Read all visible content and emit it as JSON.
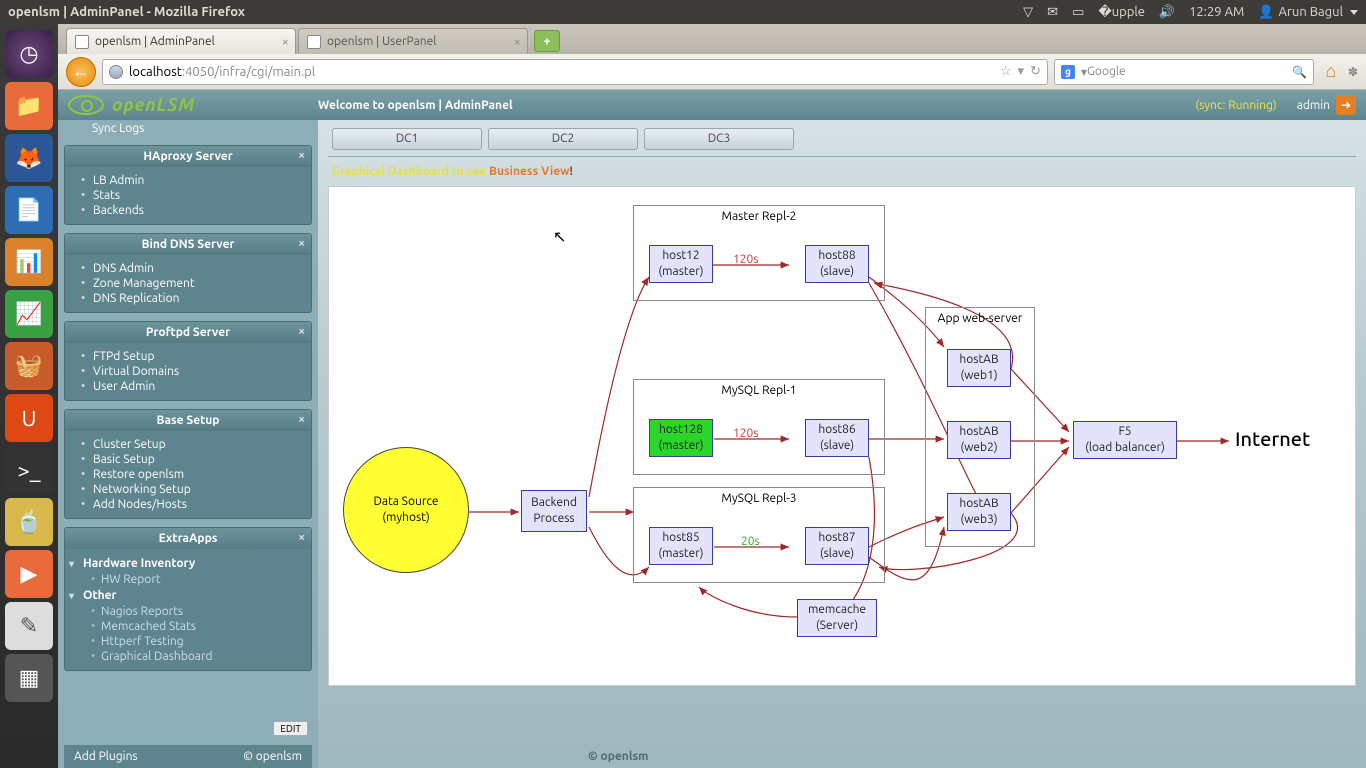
{
  "window_title": "openlsm | AdminPanel - Mozilla Firefox",
  "clock": "12:29 AM",
  "user": "Arun Bagul",
  "tabs": [
    {
      "title": "openlsm | AdminPanel",
      "active": true
    },
    {
      "title": "openlsm | UserPanel",
      "active": false
    }
  ],
  "url_host": "localhost",
  "url_port_path": ":4050/infra/cgi/main.pl",
  "search_placeholder": "Google",
  "brand": "openLSM",
  "header_welcome": "Welcome to openlsm | AdminPanel",
  "sync_status": "(sync: Running)",
  "header_user": "admin",
  "sidebar": {
    "top_link": "Sync Logs",
    "panels": [
      {
        "title": "HAproxy Server",
        "items": [
          "LB Admin",
          "Stats",
          "Backends"
        ]
      },
      {
        "title": "Bind DNS Server",
        "items": [
          "DNS Admin",
          "Zone Management",
          "DNS Replication"
        ]
      },
      {
        "title": "Proftpd Server",
        "items": [
          "FTPd Setup",
          "Virtual Domains",
          "User Admin"
        ]
      },
      {
        "title": "Base Setup",
        "items": [
          "Cluster Setup",
          "Basic Setup",
          "Restore openlsm",
          "Networking Setup",
          "Add Nodes/Hosts"
        ]
      }
    ],
    "extra_title": "ExtraApps",
    "extra_groups": [
      {
        "h": "Hardware Inventory",
        "items": [
          "HW Report"
        ]
      },
      {
        "h": "Other",
        "items": [
          "Nagios Reports",
          "Memcached Stats",
          "Httperf Testing",
          "Graphical Dashboard"
        ]
      }
    ],
    "edit": "EDIT",
    "add_plugins": "Add Plugins",
    "copyright": "© openlsm"
  },
  "dc_tabs": [
    "DC1",
    "DC2",
    "DC3"
  ],
  "caption_a": "Graphical Dashboard to see ",
  "caption_b": "Business View",
  "caption_c": "!",
  "diagram": {
    "datasource": {
      "l1": "Data Source",
      "l2": "(myhost)"
    },
    "backend": {
      "l1": "Backend",
      "l2": "Process"
    },
    "g1": {
      "title": "Master Repl-2",
      "m": {
        "l1": "host12",
        "l2": "(master)"
      },
      "s": {
        "l1": "host88",
        "l2": "(slave)"
      },
      "lag": "120s"
    },
    "g2": {
      "title": "MySQL Repl-1",
      "m": {
        "l1": "host128",
        "l2": "(master)"
      },
      "s": {
        "l1": "host86",
        "l2": "(slave)"
      },
      "lag": "120s"
    },
    "g3": {
      "title": "MySQL Repl-3",
      "m": {
        "l1": "host85",
        "l2": "(master)"
      },
      "s": {
        "l1": "host87",
        "l2": "(slave)"
      },
      "lag": "20s"
    },
    "app": {
      "title": "App web-server",
      "w1": {
        "l1": "hostAB",
        "l2": "(web1)"
      },
      "w2": {
        "l1": "hostAB",
        "l2": "(web2)"
      },
      "w3": {
        "l1": "hostAB",
        "l2": "(web3)"
      }
    },
    "f5": {
      "l1": "F5",
      "l2": "(load balancer)"
    },
    "memcache": {
      "l1": "memcache",
      "l2": "(Server)"
    },
    "internet": "Internet"
  },
  "footer_app": "© openlsm"
}
